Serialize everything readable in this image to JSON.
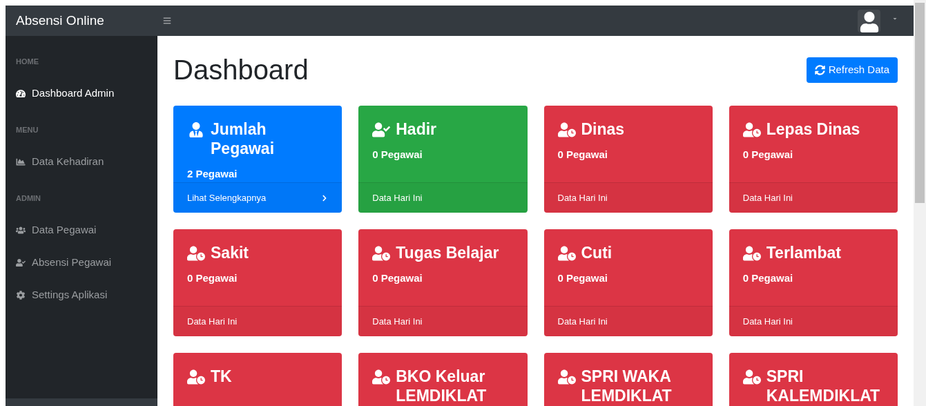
{
  "navbar": {
    "brand": "Absensi Online"
  },
  "sidebar": {
    "sections": [
      {
        "heading": "HOME",
        "items": [
          {
            "label": "Dashboard Admin",
            "kind": "dashboard",
            "selected": true
          }
        ]
      },
      {
        "heading": "MENU",
        "items": [
          {
            "label": "Data Kehadiran",
            "kind": "report",
            "selected": false
          }
        ]
      },
      {
        "heading": "ADMIN",
        "items": [
          {
            "label": "Data Pegawai",
            "kind": "staff",
            "selected": false
          },
          {
            "label": "Absensi Pegawai",
            "kind": "attendance",
            "selected": false
          },
          {
            "label": "Settings Aplikasi",
            "kind": "settings",
            "selected": false
          }
        ]
      }
    ]
  },
  "page": {
    "title": "Dashboard",
    "refresh_button": "Refresh Data"
  },
  "cards": [
    {
      "title": "Jumlah Pegawai",
      "kind": "total",
      "color": "#007bff",
      "value": "2 Pegawai",
      "footer": "Lihat Selengkapnya"
    },
    {
      "title": "Hadir",
      "kind": "present",
      "color": "#28a745",
      "value": "0 Pegawai",
      "footer": "Data Hari Ini"
    },
    {
      "title": "Dinas",
      "kind": "absent",
      "color": "#dc3545",
      "value": "0 Pegawai",
      "footer": "Data Hari Ini"
    },
    {
      "title": "Lepas Dinas",
      "kind": "absent",
      "color": "#dc3545",
      "value": "0 Pegawai",
      "footer": "Data Hari Ini"
    },
    {
      "title": "Sakit",
      "kind": "absent",
      "color": "#dc3545",
      "value": "0 Pegawai",
      "footer": "Data Hari Ini"
    },
    {
      "title": "Tugas Belajar",
      "kind": "absent",
      "color": "#dc3545",
      "value": "0 Pegawai",
      "footer": "Data Hari Ini"
    },
    {
      "title": "Cuti",
      "kind": "absent",
      "color": "#dc3545",
      "value": "0 Pegawai",
      "footer": "Data Hari Ini"
    },
    {
      "title": "Terlambat",
      "kind": "absent",
      "color": "#dc3545",
      "value": "0 Pegawai",
      "footer": "Data Hari Ini"
    },
    {
      "title": "TK",
      "kind": "absent",
      "color": "#dc3545"
    },
    {
      "title": "BKO Keluar LEMDIKLAT",
      "kind": "absent",
      "color": "#dc3545"
    },
    {
      "title": "SPRI WAKA LEMDIKLAT",
      "kind": "absent",
      "color": "#dc3545"
    },
    {
      "title": "SPRI KALEMDIKLAT",
      "kind": "absent",
      "color": "#dc3545"
    }
  ]
}
